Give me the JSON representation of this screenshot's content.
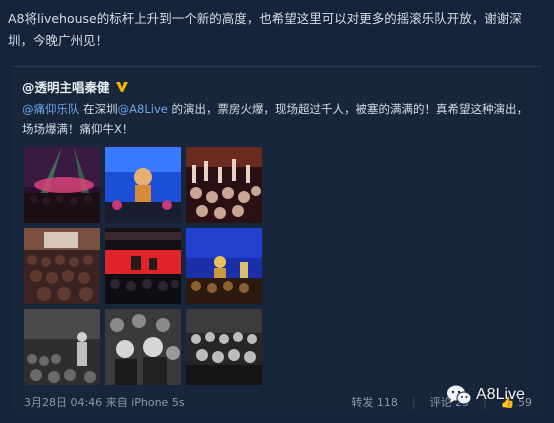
{
  "post": {
    "text": "A8将livehouse的标杆上升到一个新的高度，也希望这里可以对更多的摇滚乐队开放，谢谢深圳，今晚广州见！"
  },
  "repost": {
    "author": "@透明主唱秦健",
    "badge_icon": "verified-v-icon",
    "mention_band": "@痛仰乐队",
    "text_part1": " 在深圳",
    "mention_venue": "@A8Live",
    "text_part2": " 的演出，票房火爆，现场超过千人，被塞的满满的！真希望这种演出，场场爆满！痛仰牛X！",
    "images": [
      "concert-photo-1",
      "concert-photo-2",
      "concert-photo-3",
      "concert-photo-4",
      "concert-photo-5",
      "concert-photo-6",
      "concert-photo-7",
      "concert-photo-8",
      "concert-photo-9"
    ],
    "meta": {
      "date": "3月28日 04:46",
      "source": "来自 iPhone 5s"
    },
    "actions": {
      "repost_label": "转发",
      "repost_count": "118",
      "comment_label": "评论",
      "comment_count": "25",
      "like_count": "59"
    }
  },
  "watermark": {
    "label": "A8Live",
    "icon": "wechat-icon"
  },
  "colors": {
    "background": "#15243a",
    "link": "#6ea8e8",
    "text": "#d6dde6",
    "badge": "#f5b800"
  }
}
